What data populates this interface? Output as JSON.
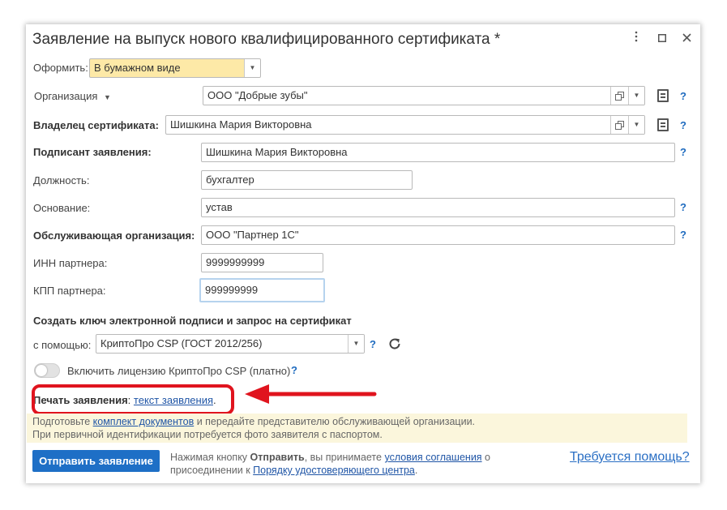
{
  "window": {
    "title": "Заявление на выпуск нового квалифицированного сертификата *",
    "menu_icon": "more-vertical-icon",
    "maximize_icon": "maximize-icon",
    "close_icon": "close-icon"
  },
  "form": {
    "oformit_label": "Оформить:",
    "oformit_value": "В бумажном виде",
    "organization_label": "Организация",
    "organization_value": "ООО \"Добрые зубы\"",
    "owner_label": "Владелец сертификата:",
    "owner_value": "Шишкина Мария Викторовна",
    "signer_label": "Подписант заявления:",
    "signer_value": "Шишкина Мария Викторовна",
    "position_label": "Должность:",
    "position_value": "бухгалтер",
    "basis_label": "Основание:",
    "basis_value": "устав",
    "service_org_label": "Обслуживающая организация:",
    "service_org_value": "ООО \"Партнер 1С\"",
    "inn_label": "ИНН партнера:",
    "inn_value": "9999999999",
    "kpp_label": "КПП партнера:",
    "kpp_value": "999999999",
    "help_mark": "?"
  },
  "key_section": {
    "heading": "Создать ключ электронной подписи и запрос на сертификат",
    "via_label": "с помощью:",
    "via_value": "КриптоПро CSP (ГОСТ 2012/256)",
    "license_label": "Включить лицензию КриптоПро CSP (платно)",
    "license_enabled": false
  },
  "print": {
    "label": "Печать заявления",
    "colon": ":",
    "link": "текст заявления",
    "dot": "."
  },
  "info": {
    "line1_prefix": "Подготовьте ",
    "line1_link": "комплект документов",
    "line1_suffix": " и передайте представителю обслуживающей организации.",
    "line2": "При первичной идентификации потребуется фото заявителя с паспортом."
  },
  "footer": {
    "send_button": "Отправить заявление",
    "agree_prefix": "Нажимая кнопку ",
    "agree_bold": "Отправить",
    "agree_mid": ", вы принимаете ",
    "agree_link1": "условия соглашения",
    "agree_suffix1": " о",
    "agree_line2_prefix": "присоединении к ",
    "agree_link2": "Порядку удостоверяющего центра",
    "agree_line2_suffix": ".",
    "help_link": "Требуется помощь?"
  },
  "colors": {
    "accent": "#1e6fc6",
    "highlight_red": "#e0141e",
    "link": "#1f55a6",
    "info_bg": "#fbf6dc",
    "dropdown_yellow": "#fde9a7"
  }
}
